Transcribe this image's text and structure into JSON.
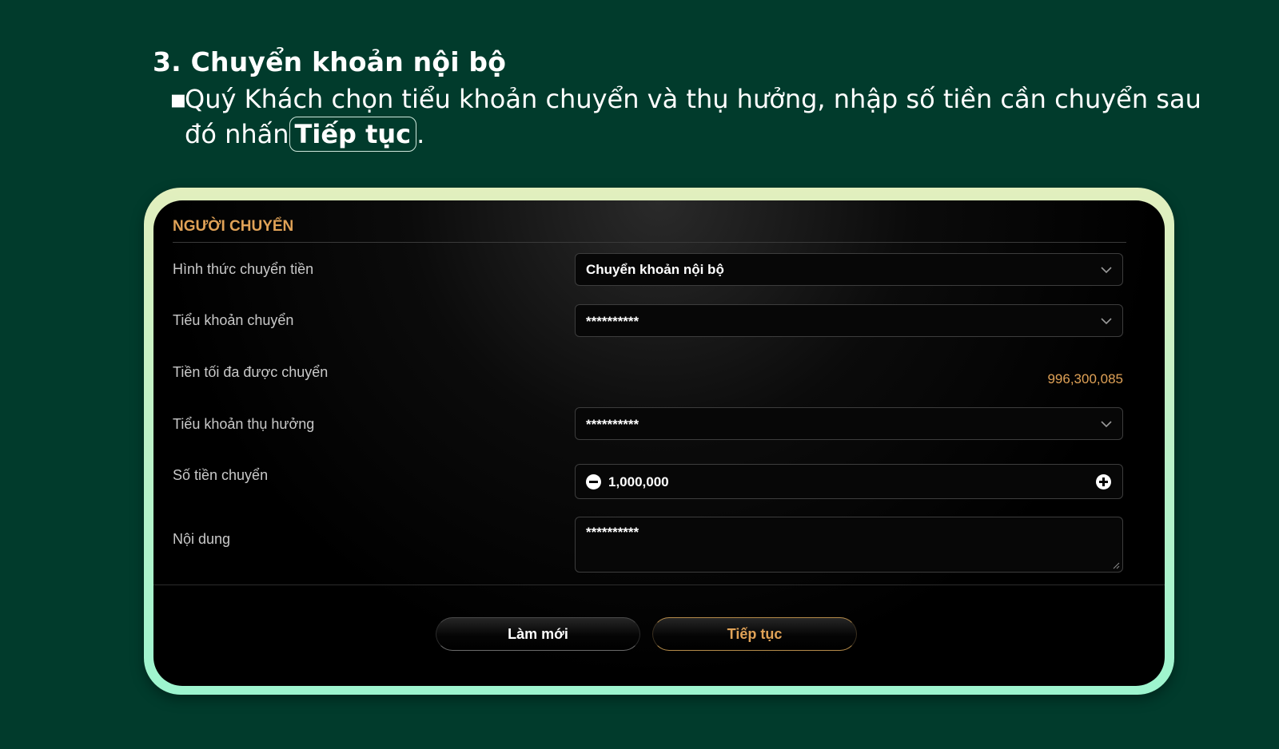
{
  "heading": "3. Chuyển khoản nội bộ",
  "instruction": {
    "bullet": "▪",
    "text_before": "Quý Khách chọn tiểu khoản chuyển và thụ hưởng, nhập số tiền cần chuyển sau đó nhấn",
    "highlight": "Tiếp tục",
    "text_after": "."
  },
  "form": {
    "section_title": "NGƯỜI CHUYỂN",
    "rows": {
      "transfer_type": {
        "label": "Hình thức chuyển tiền",
        "value": "Chuyển khoản nội bộ"
      },
      "source_subaccount": {
        "label": "Tiểu khoản chuyển",
        "value": "**********"
      },
      "max_amount": {
        "label": "Tiền tối đa được chuyển",
        "value": "996,300,085"
      },
      "beneficiary_subaccount": {
        "label": "Tiểu khoản thụ hưởng",
        "value": "**********"
      },
      "amount": {
        "label": "Số tiền chuyển",
        "value": "1,000,000"
      },
      "content": {
        "label": "Nội dung",
        "value": "**********"
      }
    },
    "buttons": {
      "reset": "Làm mới",
      "next": "Tiếp tục"
    }
  },
  "colors": {
    "background": "#013b2c",
    "accent": "#e0a257",
    "frame_top": "#e2efbe",
    "frame_bottom": "#9df5cf"
  },
  "icons": [
    "chevron-down-icon",
    "minus-circle-icon",
    "plus-circle-icon",
    "resize-grip-icon"
  ]
}
